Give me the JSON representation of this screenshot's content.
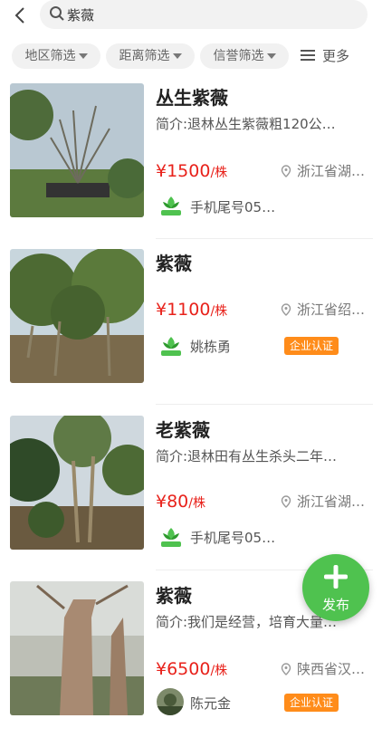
{
  "search": {
    "query": "紫薇"
  },
  "filters": [
    {
      "label": "地区筛选"
    },
    {
      "label": "距离筛选"
    },
    {
      "label": "信誉筛选"
    }
  ],
  "more_label": "更多",
  "colors": {
    "accent": "#4fc24f",
    "price": "#e8221b",
    "badge": "#ff8c1a"
  },
  "listings": [
    {
      "title": "丛生紫薇",
      "desc": "简介:退林丛生紫薇粗120公…",
      "price": "¥1500",
      "unit": "/株",
      "location": "浙江省湖…",
      "seller": "手机尾号05…",
      "avatar_icon": "plant-logo-icon",
      "badge": ""
    },
    {
      "title": "紫薇",
      "desc": "",
      "price": "¥1100",
      "unit": "/株",
      "location": "浙江省绍…",
      "seller": "姚栋勇",
      "avatar_icon": "plant-logo-icon",
      "badge": "企业认证"
    },
    {
      "title": "老紫薇",
      "desc": "简介:退林田有丛生杀头二年…",
      "price": "¥80",
      "unit": "/株",
      "location": "浙江省湖…",
      "seller": "手机尾号05…",
      "avatar_icon": "plant-logo-icon",
      "badge": ""
    },
    {
      "title": "紫薇",
      "desc": "简介:我们是经营，培育大量…",
      "price": "¥6500",
      "unit": "/株",
      "location": "陕西省汉…",
      "seller": "陈元金",
      "avatar_icon": "photo-avatar-icon",
      "badge": "企业认证"
    }
  ],
  "fab": {
    "label": "发布"
  }
}
